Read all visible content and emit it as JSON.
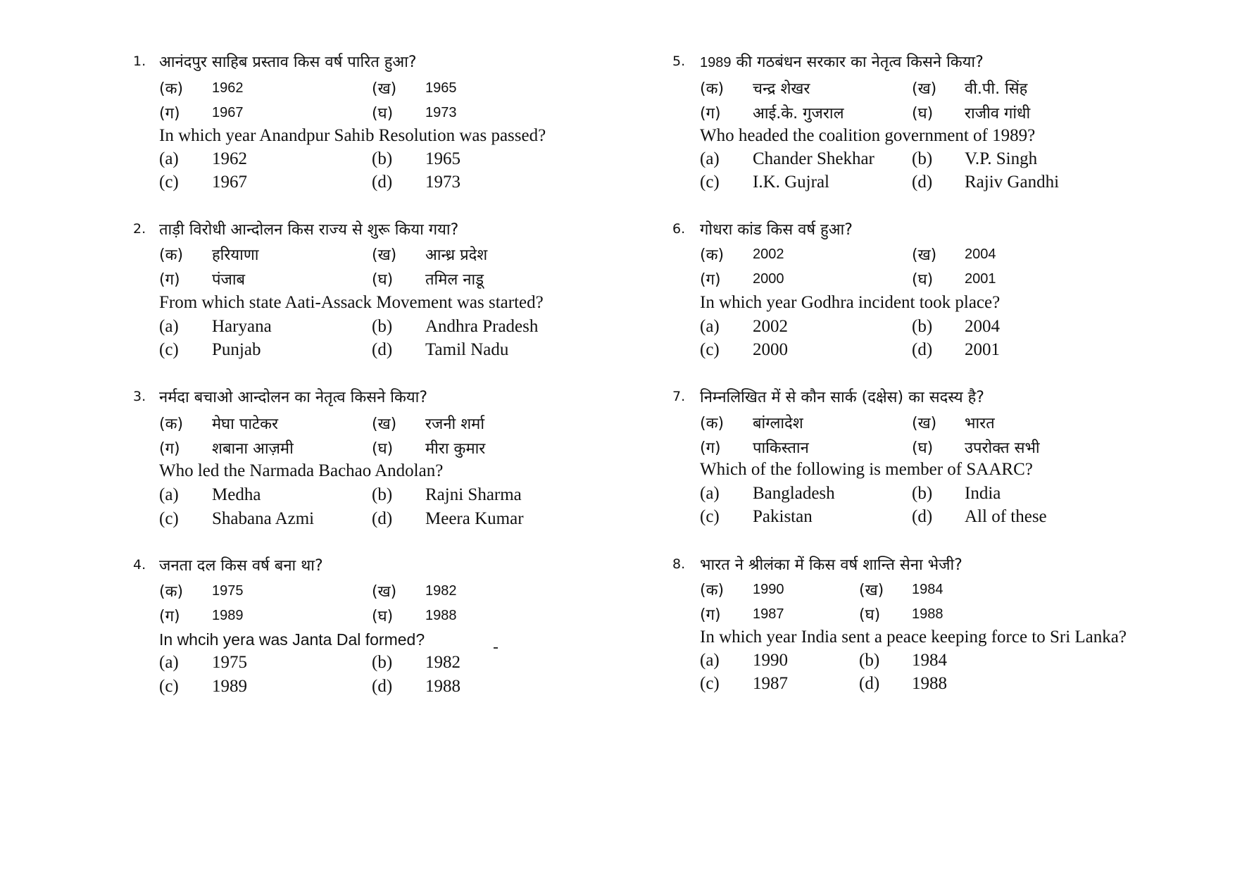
{
  "questions": [
    {
      "number": "1.",
      "hindi": {
        "text": "आनंदपुर साहिब प्रस्ताव किस वर्ष पारित हुआ?",
        "options": [
          {
            "label": "(क)",
            "value": "1962"
          },
          {
            "label": "(ख)",
            "value": "1965"
          },
          {
            "label": "(ग)",
            "value": "1967"
          },
          {
            "label": "(घ)",
            "value": "1973"
          }
        ]
      },
      "english": {
        "text": "In which year Anandpur Sahib Resolution was passed?",
        "options": [
          {
            "label": "(a)",
            "value": "1962"
          },
          {
            "label": "(b)",
            "value": "1965"
          },
          {
            "label": "(c)",
            "value": "1967"
          },
          {
            "label": "(d)",
            "value": "1973"
          }
        ]
      }
    },
    {
      "number": "2.",
      "hindi": {
        "text": "ताड़ी विरोधी आन्दोलन किस राज्य से शुरू किया गया?",
        "options": [
          {
            "label": "(क)",
            "value": "हरियाणा"
          },
          {
            "label": "(ख)",
            "value": "आन्ध्र प्रदेश"
          },
          {
            "label": "(ग)",
            "value": "पंजाब"
          },
          {
            "label": "(घ)",
            "value": "तमिल नाडू"
          }
        ]
      },
      "english": {
        "text": "From which state Aati-Assack Movement was started?",
        "options": [
          {
            "label": "(a)",
            "value": "Haryana"
          },
          {
            "label": "(b)",
            "value": "Andhra Pradesh"
          },
          {
            "label": "(c)",
            "value": "Punjab"
          },
          {
            "label": "(d)",
            "value": "Tamil Nadu"
          }
        ]
      }
    },
    {
      "number": "3.",
      "hindi": {
        "text": "नर्मदा बचाओ आन्दोलन का नेतृत्व किसने किया?",
        "options": [
          {
            "label": "(क)",
            "value": "मेघा पाटेकर"
          },
          {
            "label": "(ख)",
            "value": "रजनी शर्मा"
          },
          {
            "label": "(ग)",
            "value": "शबाना आज़मी"
          },
          {
            "label": "(घ)",
            "value": "मीरा कुमार"
          }
        ]
      },
      "english": {
        "text": "Who led the Narmada Bachao Andolan?",
        "options": [
          {
            "label": "(a)",
            "value": "Medha"
          },
          {
            "label": "(b)",
            "value": "Rajni Sharma"
          },
          {
            "label": "(c)",
            "value": "Shabana Azmi"
          },
          {
            "label": "(d)",
            "value": "Meera Kumar"
          }
        ]
      }
    },
    {
      "number": "4.",
      "hindi": {
        "text": "जनता दल किस वर्ष बना था?",
        "options": [
          {
            "label": "(क)",
            "value": "1975"
          },
          {
            "label": "(ख)",
            "value": "1982"
          },
          {
            "label": "(ग)",
            "value": "1989"
          },
          {
            "label": "(घ)",
            "value": "1988"
          }
        ]
      },
      "english": {
        "text": "In whcih yera was Janta Dal formed?",
        "options": [
          {
            "label": "(a)",
            "value": "1975"
          },
          {
            "label": "(b)",
            "value": "1982"
          },
          {
            "label": "(c)",
            "value": "1989"
          },
          {
            "label": "(d)",
            "value": "1988"
          }
        ]
      }
    },
    {
      "number": "5.",
      "hindi": {
        "text_prefix": "1989",
        "text": "की गठबंधन सरकार का नेतृत्व किसने किया?",
        "options": [
          {
            "label": "(क)",
            "value": "चन्द्र शेखर"
          },
          {
            "label": "(ख)",
            "value": "वी.पी. सिंह"
          },
          {
            "label": "(ग)",
            "value": "आई.के. गुजराल"
          },
          {
            "label": "(घ)",
            "value": "राजीव गांधी"
          }
        ]
      },
      "english": {
        "text": "Who headed the coalition government of 1989?",
        "options": [
          {
            "label": "(a)",
            "value": "Chander Shekhar"
          },
          {
            "label": "(b)",
            "value": "V.P. Singh"
          },
          {
            "label": "(c)",
            "value": "I.K. Gujral"
          },
          {
            "label": "(d)",
            "value": "Rajiv Gandhi"
          }
        ]
      }
    },
    {
      "number": "6.",
      "hindi": {
        "text": "गोधरा कांड किस वर्ष हुआ?",
        "options": [
          {
            "label": "(क)",
            "value": "2002"
          },
          {
            "label": "(ख)",
            "value": "2004"
          },
          {
            "label": "(ग)",
            "value": "2000"
          },
          {
            "label": "(घ)",
            "value": "2001"
          }
        ]
      },
      "english": {
        "text": "In which year Godhra incident took place?",
        "options": [
          {
            "label": "(a)",
            "value": "2002"
          },
          {
            "label": "(b)",
            "value": "2004"
          },
          {
            "label": "(c)",
            "value": "2000"
          },
          {
            "label": "(d)",
            "value": "2001"
          }
        ]
      }
    },
    {
      "number": "7.",
      "hindi": {
        "text": "निम्नलिखित में से कौन सार्क (दक्षेस) का सदस्य है?",
        "options": [
          {
            "label": "(क)",
            "value": "बांग्लादेश"
          },
          {
            "label": "(ख)",
            "value": "भारत"
          },
          {
            "label": "(ग)",
            "value": "पाकिस्तान"
          },
          {
            "label": "(घ)",
            "value": "उपरोक्त सभी"
          }
        ]
      },
      "english": {
        "text": "Which of the following is member of SAARC?",
        "options": [
          {
            "label": "(a)",
            "value": "Bangladesh"
          },
          {
            "label": "(b)",
            "value": "India"
          },
          {
            "label": "(c)",
            "value": "Pakistan"
          },
          {
            "label": "(d)",
            "value": "All of these"
          }
        ]
      }
    },
    {
      "number": "8.",
      "hindi": {
        "text": "भारत ने श्रीलंका में किस वर्ष शान्ति सेना भेजी?",
        "options": [
          {
            "label": "(क)",
            "value": "1990"
          },
          {
            "label": "(ख)",
            "value": "1984"
          },
          {
            "label": "(ग)",
            "value": "1987"
          },
          {
            "label": "(घ)",
            "value": "1988"
          }
        ]
      },
      "english": {
        "text": "In which year India sent a peace keeping force to Sri Lanka?",
        "options": [
          {
            "label": "(a)",
            "value": "1990"
          },
          {
            "label": "(b)",
            "value": "1984"
          },
          {
            "label": "(c)",
            "value": "1987"
          },
          {
            "label": "(d)",
            "value": "1988"
          }
        ]
      }
    }
  ]
}
